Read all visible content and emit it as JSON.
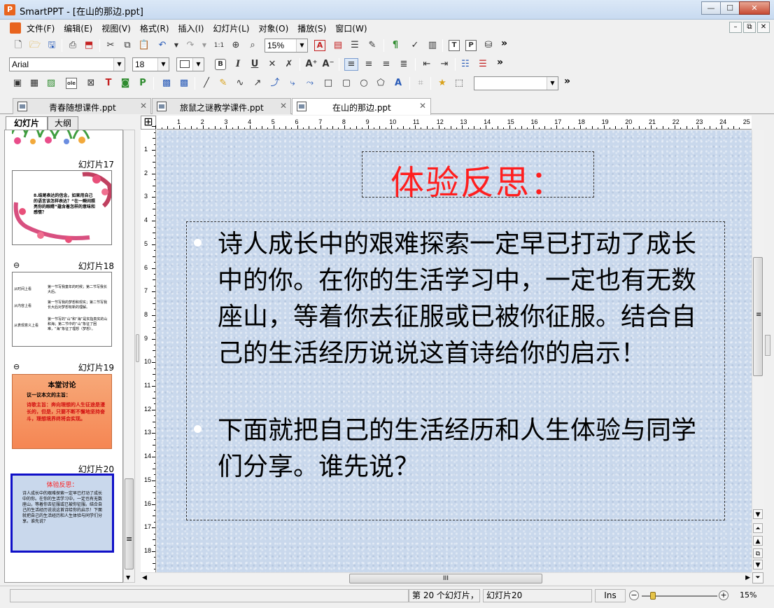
{
  "window": {
    "title": "SmartPPT - [在山的那边.ppt]",
    "app_icon": "P",
    "btn_minimize": "—",
    "btn_maximize": "☐",
    "btn_close": "✕"
  },
  "menu": {
    "items": [
      "文件(F)",
      "编辑(E)",
      "视图(V)",
      "格式(R)",
      "插入(I)",
      "幻灯片(L)",
      "对象(O)",
      "播放(S)",
      "窗口(W)"
    ],
    "mdi_min": "–",
    "mdi_restore": "⧉",
    "mdi_close": "✕"
  },
  "toolbar": {
    "zoom_value": "15%",
    "font_name": "Arial",
    "font_size": "18",
    "chevron": "»",
    "combo_arrow": "▼"
  },
  "doc_tabs": [
    {
      "label": "青春随想课件.ppt",
      "close": "✕"
    },
    {
      "label": "旅鼠之谜教学课件.ppt",
      "close": "✕"
    },
    {
      "label": "在山的那边.ppt",
      "close": "✕"
    }
  ],
  "left_panel": {
    "tab_slides": "幻灯片",
    "tab_outline": "大纲",
    "slides": [
      {
        "label": "幻灯片17",
        "text": "8.结尾表达的信念，如果用自己的语言该怎样表达？“在一瞬间照亮你的眼睛”蕴含着怎样的意味和感情？"
      },
      {
        "label": "幻灯片18",
        "rows": [
          {
            "left": "从时间上看",
            "right": "第一节写我童年的时候；第二节写我长大后。"
          },
          {
            "left": "从内容上看",
            "right": "第一节写我的梦想和现实；第二节写我长大后对梦想有新的理解。"
          },
          {
            "left": "从表现意义上看",
            "right": "第一节写的“山”和“海”是实指真实的山和海；第二节中的“山”象征了困难，“海”象征了理想（梦想）。"
          }
        ]
      },
      {
        "label": "幻灯片19",
        "title": "本堂讨论",
        "subtitle": "议一议本文的主旨：",
        "text": "诗歌主旨：奔向理想的人生征途是漫长的，但是，只要不断不懈地坚持奋斗，理想境界终将会实现。"
      },
      {
        "label": "幻灯片20",
        "title": "体验反思：",
        "text": "诗人成长中的艰难探索一定早已打动了成长中的你。在你的生活学习中，一定也有无数座山，等着你去征服或已被你征服。结合自己的生活经历说说这首诗给你的启示！下面就把自己的生活经历和人生体验与同学们分享。谁先说？"
      }
    ]
  },
  "ruler": {
    "corner": "⊞",
    "h_numbers": [
      "1",
      "2",
      "3",
      "4",
      "5",
      "6",
      "7",
      "8",
      "9",
      "10",
      "11",
      "12",
      "13",
      "14",
      "15",
      "16",
      "17",
      "18",
      "19",
      "20",
      "21",
      "22",
      "23",
      "24",
      "25"
    ],
    "v_numbers": [
      "1",
      "2",
      "3",
      "4",
      "5",
      "6",
      "7",
      "8",
      "9",
      "10",
      "11",
      "12",
      "13",
      "14",
      "15",
      "16",
      "17",
      "18"
    ]
  },
  "slide": {
    "title": "体验反思：",
    "para1": "诗人成长中的艰难探索一定早已打动了成长中的你。在你的生活学习中，一定也有无数座山，等着你去征服或已被你征服。结合自己的生活经历说说这首诗给你的启示！",
    "para2": "下面就把自己的生活经历和人生体验与同学们分享。谁先说？",
    "title_color": "#ff1e1e"
  },
  "scroll": {
    "up": "▲",
    "down": "▼",
    "left": "◀",
    "right": "▶",
    "grip": "≡",
    "hgrip": "III",
    "nav_first": "⏶",
    "nav_prev": "▲",
    "nav_list": "⧉",
    "nav_next": "▼",
    "nav_last": "⏷"
  },
  "status": {
    "slide_count": "第 20 个幻灯片，",
    "slide_name": "幻灯片20",
    "mode": "Ins",
    "zoom": "15%",
    "zoom_minus": "−",
    "zoom_plus": "+"
  }
}
